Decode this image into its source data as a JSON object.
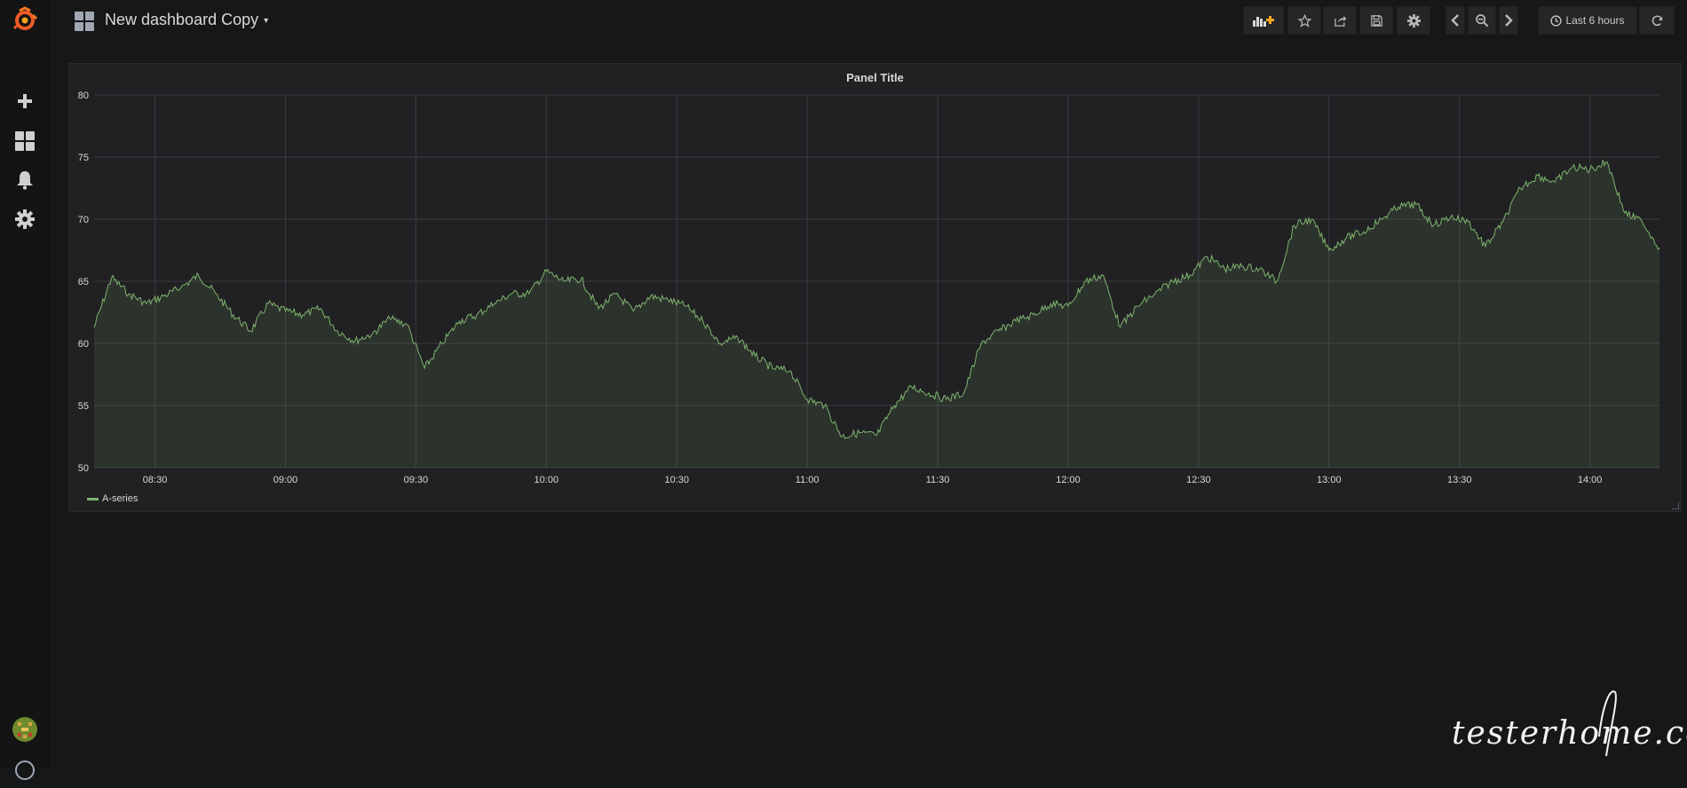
{
  "sidebar": {
    "items": [
      {
        "name": "grafana-logo-icon"
      },
      {
        "name": "plus-icon"
      },
      {
        "name": "dashboards-icon"
      },
      {
        "name": "bell-icon"
      },
      {
        "name": "gear-icon"
      },
      {
        "name": "avatar"
      },
      {
        "name": "help-icon"
      }
    ]
  },
  "navbar": {
    "title": "New dashboard Copy",
    "caret": "▾",
    "time_range": "Last 6 hours",
    "buttons": [
      "add-panel-icon",
      "star-icon",
      "share-icon",
      "save-icon",
      "gear-icon",
      "chevron-left-icon",
      "zoom-out-icon",
      "chevron-right-icon",
      "clock-icon",
      "refresh-icon"
    ]
  },
  "panel": {
    "title": "Panel Title",
    "legend": [
      {
        "name": "A-series",
        "color": "#7eb26d"
      }
    ]
  },
  "chart_data": {
    "type": "line",
    "title": "Panel Title",
    "xlabel": "",
    "ylabel": "",
    "x_tick_labels": [
      "08:30",
      "09:00",
      "09:30",
      "10:00",
      "10:30",
      "11:00",
      "11:30",
      "12:00",
      "12:30",
      "13:00",
      "13:30",
      "14:00"
    ],
    "y_tick_labels": [
      "50",
      "55",
      "60",
      "65",
      "70",
      "75",
      "80"
    ],
    "ylim": [
      50,
      80
    ],
    "xlim": [
      "08:16",
      "14:16"
    ],
    "grid": true,
    "fill": true,
    "legend_position": "bottom-left",
    "series": [
      {
        "name": "A-series",
        "color": "#7eb26d",
        "points": [
          [
            "08:16",
            61.3
          ],
          [
            "08:20",
            65.3
          ],
          [
            "08:24",
            64.0
          ],
          [
            "08:28",
            63.2
          ],
          [
            "08:32",
            63.8
          ],
          [
            "08:36",
            64.5
          ],
          [
            "08:40",
            65.5
          ],
          [
            "08:44",
            64.0
          ],
          [
            "08:48",
            62.3
          ],
          [
            "08:52",
            61.0
          ],
          [
            "08:56",
            63.2
          ],
          [
            "09:00",
            62.6
          ],
          [
            "09:04",
            62.3
          ],
          [
            "09:08",
            62.8
          ],
          [
            "09:12",
            61.0
          ],
          [
            "09:16",
            60.2
          ],
          [
            "09:20",
            60.8
          ],
          [
            "09:24",
            62.0
          ],
          [
            "09:28",
            61.5
          ],
          [
            "09:32",
            58.0
          ],
          [
            "09:36",
            60.0
          ],
          [
            "09:40",
            61.8
          ],
          [
            "09:44",
            62.3
          ],
          [
            "09:48",
            63.2
          ],
          [
            "09:52",
            64.0
          ],
          [
            "09:56",
            64.0
          ],
          [
            "10:00",
            65.8
          ],
          [
            "10:04",
            65.0
          ],
          [
            "10:08",
            65.2
          ],
          [
            "10:12",
            62.8
          ],
          [
            "10:16",
            64.0
          ],
          [
            "10:20",
            62.6
          ],
          [
            "10:24",
            63.8
          ],
          [
            "10:28",
            63.5
          ],
          [
            "10:32",
            63.0
          ],
          [
            "10:36",
            61.8
          ],
          [
            "10:40",
            60.0
          ],
          [
            "10:44",
            60.5
          ],
          [
            "10:48",
            59.0
          ],
          [
            "10:52",
            58.0
          ],
          [
            "10:56",
            57.8
          ],
          [
            "11:00",
            55.5
          ],
          [
            "11:04",
            55.0
          ],
          [
            "11:08",
            52.5
          ],
          [
            "11:12",
            52.8
          ],
          [
            "11:16",
            52.6
          ],
          [
            "11:20",
            55.0
          ],
          [
            "11:24",
            56.5
          ],
          [
            "11:28",
            56.0
          ],
          [
            "11:32",
            55.5
          ],
          [
            "11:36",
            56.0
          ],
          [
            "11:40",
            60.0
          ],
          [
            "11:44",
            61.0
          ],
          [
            "11:48",
            61.8
          ],
          [
            "11:52",
            62.3
          ],
          [
            "11:56",
            63.2
          ],
          [
            "12:00",
            63.0
          ],
          [
            "12:04",
            65.0
          ],
          [
            "12:08",
            65.5
          ],
          [
            "12:12",
            61.3
          ],
          [
            "12:16",
            63.0
          ],
          [
            "12:20",
            64.0
          ],
          [
            "12:24",
            65.0
          ],
          [
            "12:28",
            65.5
          ],
          [
            "12:32",
            67.0
          ],
          [
            "12:36",
            66.0
          ],
          [
            "12:40",
            66.2
          ],
          [
            "12:44",
            66.0
          ],
          [
            "12:48",
            65.0
          ],
          [
            "12:52",
            69.5
          ],
          [
            "12:56",
            70.0
          ],
          [
            "13:00",
            67.5
          ],
          [
            "13:04",
            68.5
          ],
          [
            "13:08",
            69.0
          ],
          [
            "13:12",
            70.0
          ],
          [
            "13:16",
            71.0
          ],
          [
            "13:20",
            71.2
          ],
          [
            "13:24",
            69.5
          ],
          [
            "13:28",
            70.2
          ],
          [
            "13:32",
            69.8
          ],
          [
            "13:36",
            67.8
          ],
          [
            "13:40",
            69.8
          ],
          [
            "13:44",
            72.5
          ],
          [
            "13:48",
            73.5
          ],
          [
            "13:52",
            73.0
          ],
          [
            "13:56",
            74.2
          ],
          [
            "14:00",
            74.0
          ],
          [
            "14:04",
            74.6
          ],
          [
            "14:08",
            70.5
          ],
          [
            "14:12",
            69.8
          ],
          [
            "14:16",
            67.7
          ]
        ]
      }
    ]
  },
  "watermark": {
    "text": "testerhome.com"
  }
}
